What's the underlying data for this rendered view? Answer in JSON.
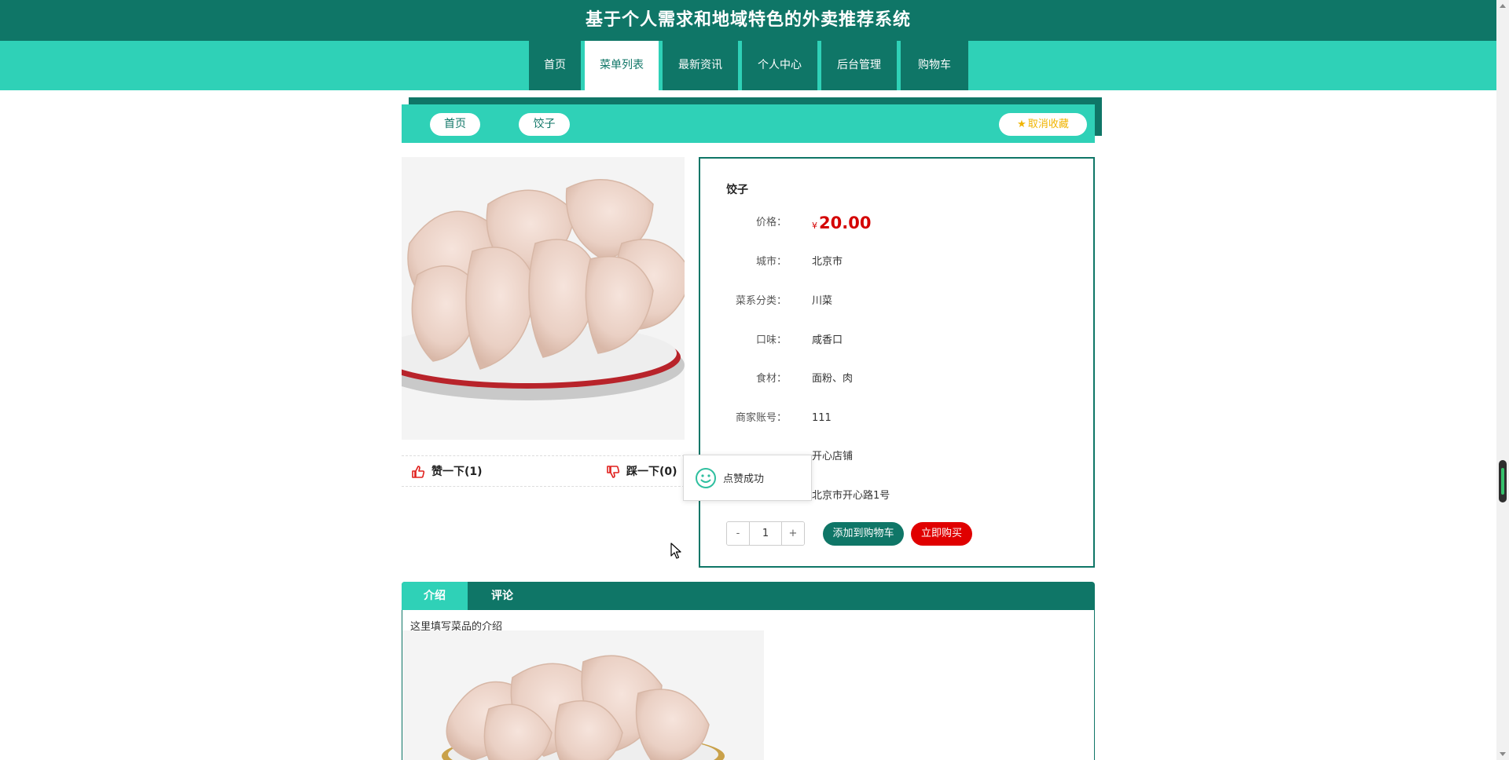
{
  "header": {
    "title": "基于个人需求和地域特色的外卖推荐系统"
  },
  "nav": [
    {
      "label": "首页",
      "active": false
    },
    {
      "label": "菜单列表",
      "active": true
    },
    {
      "label": "最新资讯",
      "active": false
    },
    {
      "label": "个人中心",
      "active": false
    },
    {
      "label": "后台管理",
      "active": false
    },
    {
      "label": "购物车",
      "active": false
    }
  ],
  "breadcrumb": {
    "home": "首页",
    "current": "饺子",
    "favorite": "取消收藏"
  },
  "product": {
    "name": "饺子",
    "currency": "¥",
    "fields": [
      {
        "label": "价格：",
        "value": "20.00"
      },
      {
        "label": "城市：",
        "value": "北京市"
      },
      {
        "label": "菜系分类：",
        "value": "川菜"
      },
      {
        "label": "口味：",
        "value": "咸香口"
      },
      {
        "label": "食材：",
        "value": "面粉、肉"
      },
      {
        "label": "商家账号：",
        "value": "111"
      },
      {
        "label": "",
        "value": "开心店铺"
      },
      {
        "label": "",
        "value": "北京市开心路1号"
      }
    ],
    "quantity": "1",
    "minus": "-",
    "plus": "+",
    "add_to_cart": "添加到购物车",
    "buy_now": "立即购买"
  },
  "likes": {
    "up": "赞一下(1)",
    "down": "踩一下(0)"
  },
  "toast": {
    "message": "点赞成功"
  },
  "tabs": {
    "intro": "介绍",
    "comment": "评论",
    "intro_text": "这里填写菜品的介绍"
  },
  "colors": {
    "primary": "#0f7667",
    "accent": "#2fd1b7",
    "price": "#d40000",
    "buy": "#e00000",
    "favorite": "#f0b400"
  }
}
